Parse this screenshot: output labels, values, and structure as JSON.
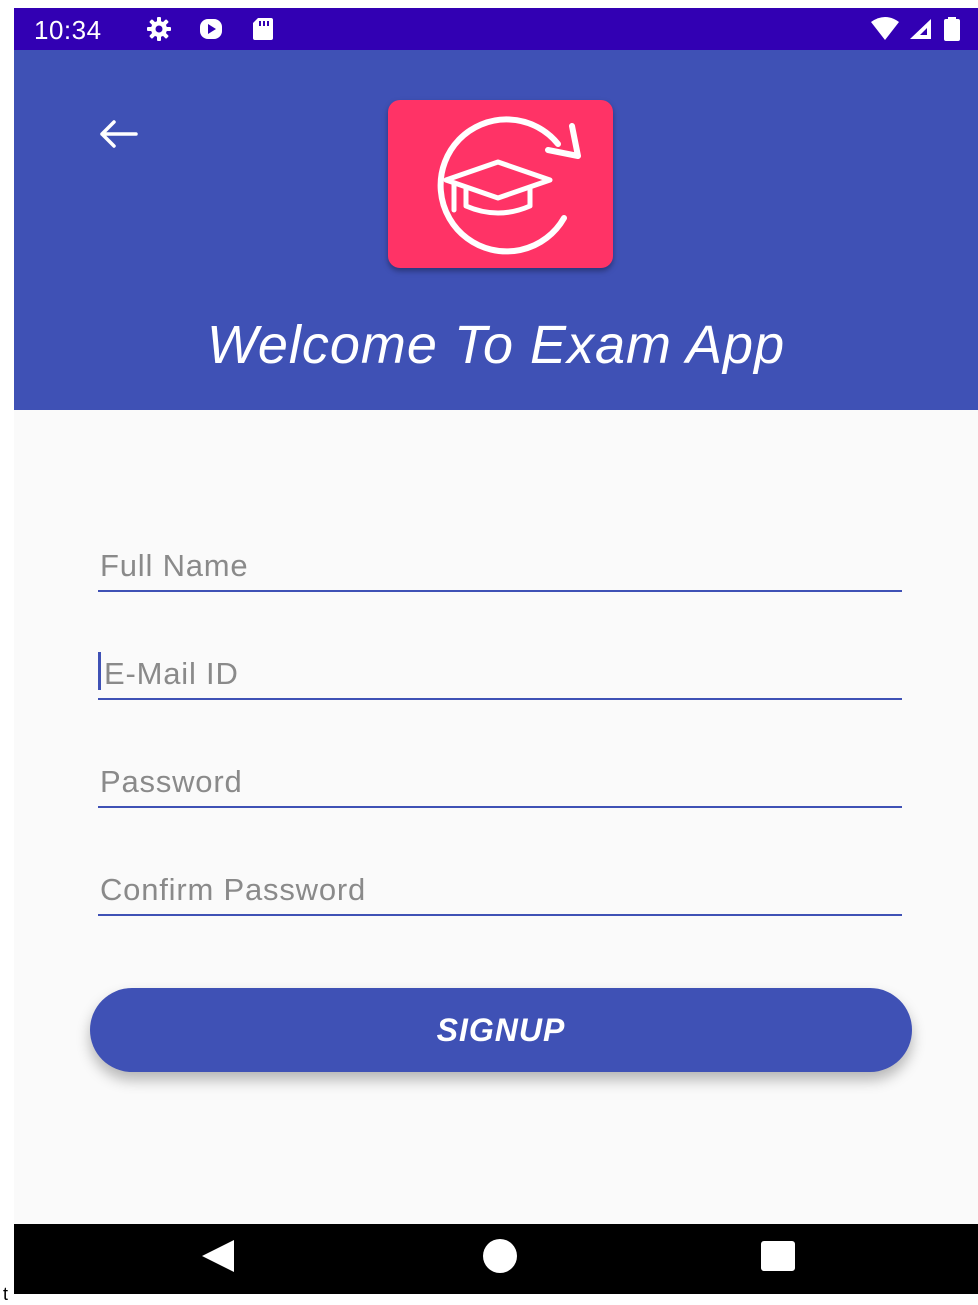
{
  "status_bar": {
    "time": "10:34",
    "icons": [
      "settings-icon",
      "play-icon",
      "sd-card-icon",
      "wifi-icon",
      "signal-icon",
      "battery-icon"
    ]
  },
  "header": {
    "title": "Welcome To Exam App",
    "logo": "graduation-cap-refresh-logo",
    "colors": {
      "background": "#3f51b5",
      "logo_background": "#ff3366"
    }
  },
  "form": {
    "full_name": {
      "placeholder": "Full Name",
      "value": ""
    },
    "email": {
      "placeholder": "E-Mail ID",
      "value": ""
    },
    "password": {
      "placeholder": "Password",
      "value": ""
    },
    "confirm_password": {
      "placeholder": "Confirm Password",
      "value": ""
    },
    "signup_label": "SIGNUP"
  },
  "nav_bar": {
    "buttons": [
      "back-triangle-icon",
      "home-circle-icon",
      "recents-square-icon"
    ]
  },
  "edge_text": "t"
}
